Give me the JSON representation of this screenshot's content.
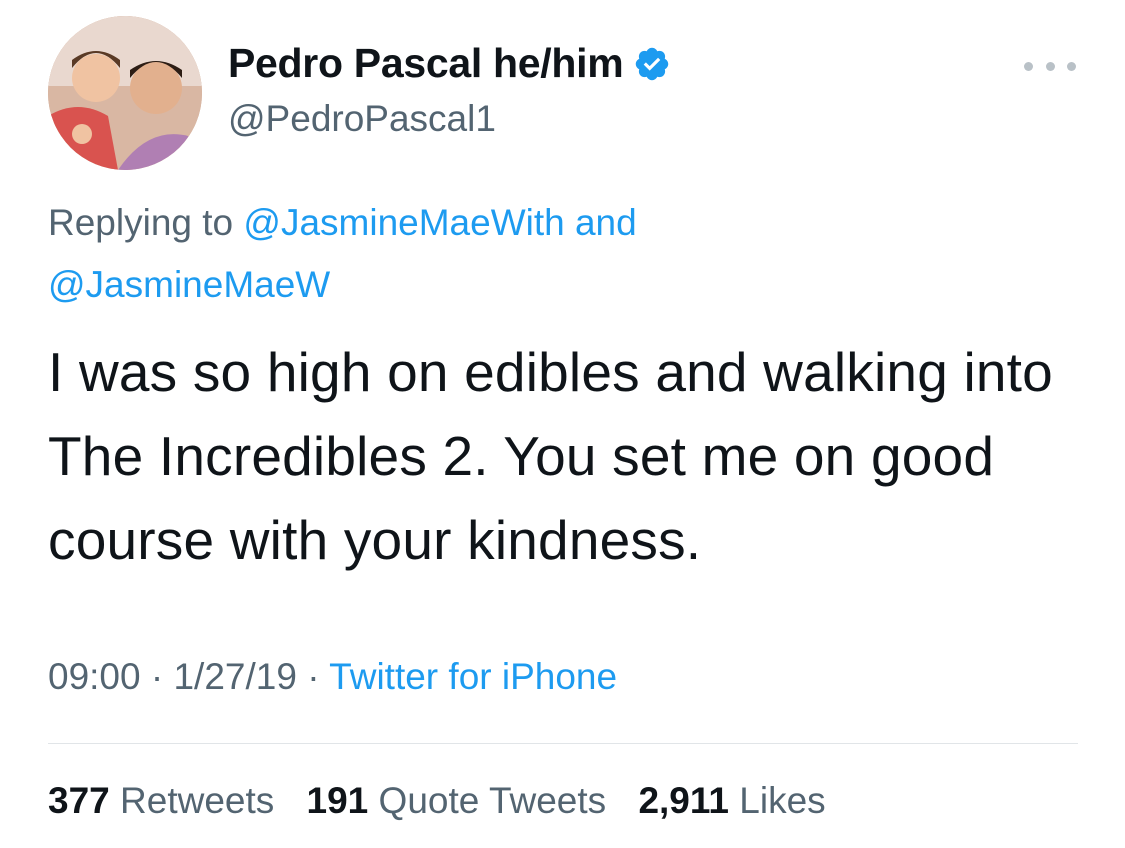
{
  "author": {
    "display_name": "Pedro Pascal he/him",
    "handle": "@PedroPascal1",
    "verified": true
  },
  "reply_context": {
    "prefix": "Replying to",
    "mention_1": "@JasmineMaeWith",
    "joiner": "and",
    "mention_2": "@JasmineMaeW"
  },
  "tweet": {
    "text": "I was so high on edibles and walking into The Incredibles 2. You set me on good course with your kindness."
  },
  "meta": {
    "time": "09:00",
    "separator": "·",
    "date": "1/27/19",
    "source": "Twitter for iPhone"
  },
  "stats": {
    "retweets_count": "377",
    "retweets_label": "Retweets",
    "quotes_count": "191",
    "quotes_label": "Quote Tweets",
    "likes_count": "2,911",
    "likes_label": "Likes"
  },
  "icons": {
    "verified": "verified-badge-icon",
    "more": "more-options-icon"
  },
  "colors": {
    "accent": "#1d9bf0",
    "text": "#0f1419",
    "secondary": "#536471"
  }
}
